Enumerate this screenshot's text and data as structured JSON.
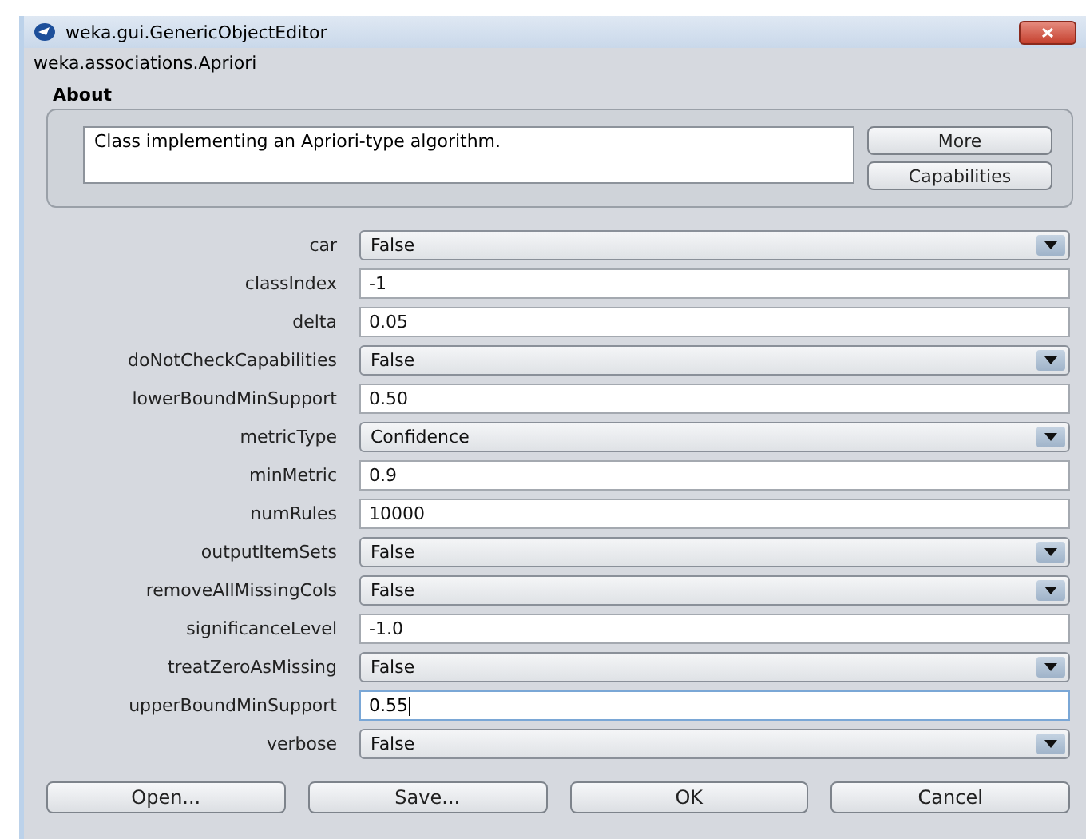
{
  "window": {
    "title": "weka.gui.GenericObjectEditor"
  },
  "class_name": "weka.associations.Apriori",
  "about": {
    "title": "About",
    "text": "Class implementing an Apriori-type algorithm.",
    "buttons": [
      "More",
      "Capabilities"
    ]
  },
  "properties": [
    {
      "label": "car",
      "kind": "dropdown",
      "value": "False"
    },
    {
      "label": "classIndex",
      "kind": "text",
      "value": "-1",
      "focused": false
    },
    {
      "label": "delta",
      "kind": "text",
      "value": "0.05",
      "focused": false
    },
    {
      "label": "doNotCheckCapabilities",
      "kind": "dropdown",
      "value": "False"
    },
    {
      "label": "lowerBoundMinSupport",
      "kind": "text",
      "value": "0.50",
      "focused": false
    },
    {
      "label": "metricType",
      "kind": "dropdown",
      "value": "Confidence"
    },
    {
      "label": "minMetric",
      "kind": "text",
      "value": "0.9",
      "focused": false
    },
    {
      "label": "numRules",
      "kind": "text",
      "value": "10000",
      "focused": false
    },
    {
      "label": "outputItemSets",
      "kind": "dropdown",
      "value": "False"
    },
    {
      "label": "removeAllMissingCols",
      "kind": "dropdown",
      "value": "False"
    },
    {
      "label": "significanceLevel",
      "kind": "text",
      "value": "-1.0",
      "focused": false
    },
    {
      "label": "treatZeroAsMissing",
      "kind": "dropdown",
      "value": "False"
    },
    {
      "label": "upperBoundMinSupport",
      "kind": "text",
      "value": "0.55",
      "focused": true
    },
    {
      "label": "verbose",
      "kind": "dropdown",
      "value": "False"
    }
  ],
  "buttons": [
    "Open...",
    "Save...",
    "OK",
    "Cancel"
  ]
}
